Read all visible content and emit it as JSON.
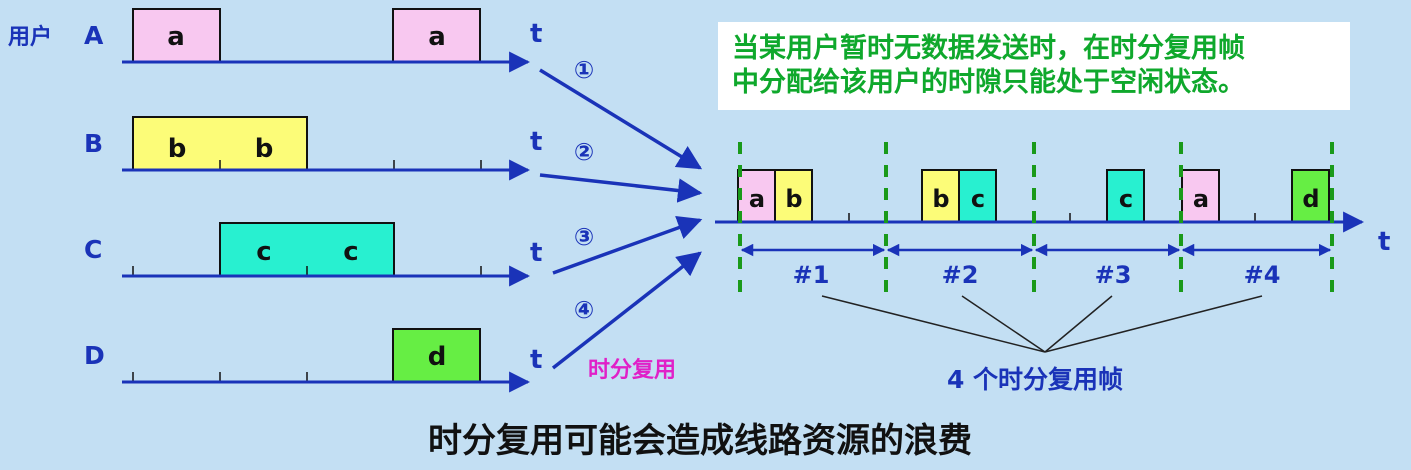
{
  "users_label": "用户",
  "t_label": "t",
  "users": [
    {
      "name": "A",
      "blocks": [
        "a",
        "a"
      ]
    },
    {
      "name": "B",
      "blocks": [
        "b",
        "b"
      ]
    },
    {
      "name": "C",
      "blocks": [
        "c",
        "c"
      ]
    },
    {
      "name": "D",
      "blocks": [
        "d"
      ]
    }
  ],
  "channel_numbers": [
    "①",
    "②",
    "③",
    "④"
  ],
  "mux_label": "时分复用",
  "note": [
    "当某用户暂时无数据发送时，在时分复用帧",
    "中分配给该用户的时隙只能处于空闲状态。"
  ],
  "frames": [
    {
      "label": "#1",
      "slots": [
        "a",
        "b"
      ]
    },
    {
      "label": "#2",
      "slots": [
        "b",
        "c"
      ]
    },
    {
      "label": "#3",
      "slots": [
        "c"
      ]
    },
    {
      "label": "#4",
      "slots": [
        "a",
        "d"
      ]
    }
  ],
  "frames_caption": "4 个时分复用帧",
  "title": "时分复用可能会造成线路资源的浪费",
  "colors": {
    "a": "#f8c8f0",
    "b": "#fcfc78",
    "c": "#28f0d0",
    "d": "#66ee44",
    "line": "#1a33b8",
    "dash": "#1a9a1a",
    "mux": "#e020c8",
    "note": "#0fa82c"
  }
}
